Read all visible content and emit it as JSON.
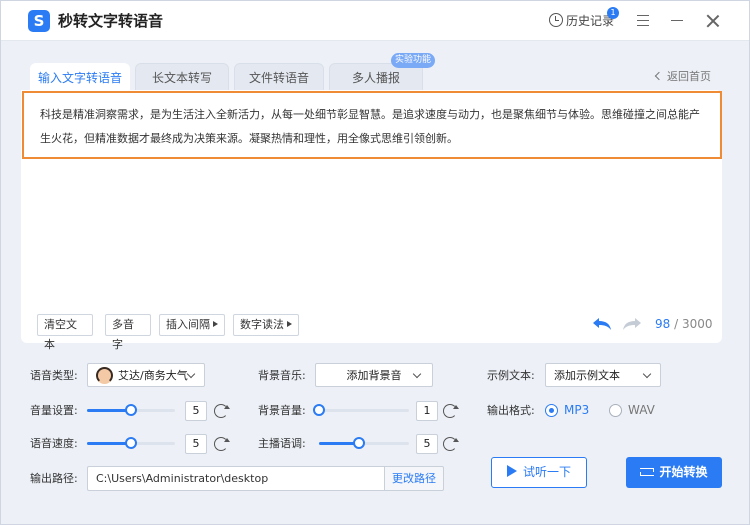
{
  "app": {
    "logo_letter": "S",
    "title": "秒转文字转语音",
    "history_label": "历史记录",
    "history_badge": "1"
  },
  "tabs": [
    {
      "label": "输入文字转语音",
      "active": true
    },
    {
      "label": "长文本转写",
      "active": false
    },
    {
      "label": "文件转语音",
      "active": false
    },
    {
      "label": "多人播报",
      "active": false
    }
  ],
  "tab_badge": "实验功能",
  "back_home": "返回首页",
  "editor": {
    "text": "科技是精准洞察需求，是为生活注入全新活力，从每一处细节彰显智慧。是追求速度与动力，也是聚焦细节与体验。思维碰撞之间总能产生火花，但精准数据才最终成为决策来源。凝聚热情和理性，用全像式思维引领创新。",
    "tools": [
      "清空文本",
      "多音字",
      "插入间隔",
      "数字读法"
    ],
    "char_count": "98",
    "char_limit": "3000",
    "count_separator": "/"
  },
  "settings": {
    "voice_type_label": "语音类型:",
    "voice_name": "艾达/商务大气",
    "bg_music_label": "背景音乐:",
    "bg_music_value": "添加背景音",
    "sample_text_label": "示例文本:",
    "sample_text_value": "添加示例文本",
    "volume_label": "音量设置:",
    "volume_value": "5",
    "volume_level": 0.5,
    "bg_volume_label": "背景音量:",
    "bg_volume_value": "1",
    "bg_volume_level": 0.0,
    "speed_label": "语音速度:",
    "speed_value": "5",
    "speed_level": 0.5,
    "pitch_label": "主播语调:",
    "pitch_value": "5",
    "pitch_level": 0.44,
    "output_format_label": "输出格式:",
    "formats": [
      "MP3",
      "WAV"
    ],
    "selected_format": "MP3",
    "output_path_label": "输出路径:",
    "output_path": "C:\\Users\\Administrator\\desktop",
    "change_path_label": "更改路径"
  },
  "actions": {
    "listen_label": "试听一下",
    "convert_label": "开始转换"
  },
  "colors": {
    "accent": "#2a7bf4",
    "highlight_border": "#ef8a35"
  }
}
